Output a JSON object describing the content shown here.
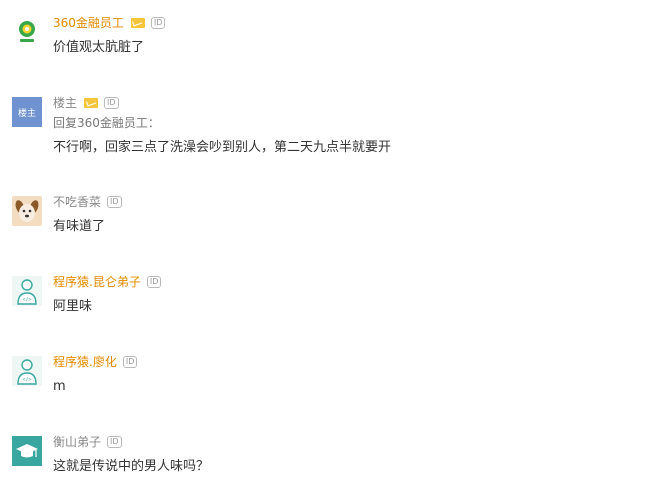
{
  "comments": [
    {
      "username": "360金融员工",
      "name_color": "orange",
      "has_v": true,
      "id_badge": "ID",
      "text": "价值观太肮脏了",
      "avatar": "360-logo-icon"
    },
    {
      "username": "楼主",
      "name_color": "gray",
      "has_v": true,
      "id_badge": "ID",
      "reply_to": "回复360金融员工：",
      "text": "不行啊，回家三点了洗澡会吵到别人，第二天九点半就要开",
      "avatar_text": "楼主"
    },
    {
      "username": "不吃香菜",
      "name_color": "gray",
      "has_v": false,
      "id_badge": "ID",
      "text": "有味道了",
      "avatar": "dog-face-icon"
    },
    {
      "username": "程序猿.昆仑弟子",
      "name_color": "orange",
      "has_v": false,
      "id_badge": "ID",
      "text": "阿里味",
      "avatar": "coder-avatar-icon"
    },
    {
      "username": "程序猿.廖化",
      "name_color": "orange",
      "has_v": false,
      "id_badge": "ID",
      "text": "m",
      "avatar": "coder-avatar-icon"
    },
    {
      "username": "衡山弟子",
      "name_color": "gray",
      "has_v": false,
      "id_badge": "ID",
      "text": "这就是传说中的男人味吗？",
      "avatar": "graduation-cap-icon"
    }
  ]
}
